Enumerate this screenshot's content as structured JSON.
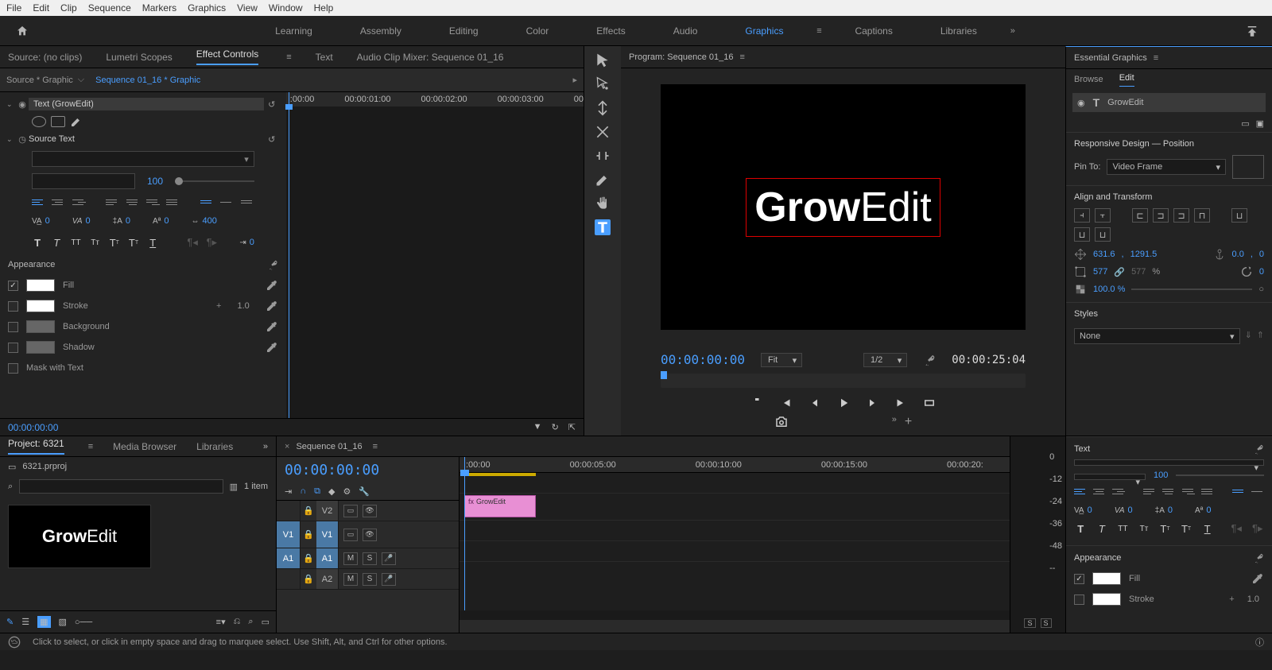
{
  "menu": {
    "items": [
      "File",
      "Edit",
      "Clip",
      "Sequence",
      "Markers",
      "Graphics",
      "View",
      "Window",
      "Help"
    ]
  },
  "workspaces": {
    "items": [
      "Learning",
      "Assembly",
      "Editing",
      "Color",
      "Effects",
      "Audio",
      "Graphics",
      "Captions",
      "Libraries"
    ],
    "active": "Graphics"
  },
  "sourcePanel": {
    "tabs": [
      "Source: (no clips)",
      "Lumetri Scopes",
      "Effect Controls",
      "Text",
      "Audio Clip Mixer: Sequence 01_16"
    ],
    "active": "Effect Controls"
  },
  "effectControls": {
    "source": "Source * Graphic",
    "sequence": "Sequence 01_16 * Graphic",
    "ruler": [
      ":00:00",
      "00:00:01:00",
      "00:00:02:00",
      "00:00:03:00",
      "00"
    ],
    "textLayer": "Text (GrowEdit)",
    "sourceText": "Source Text",
    "fontSize": "100",
    "tracking": "0",
    "kerning": "0",
    "leading": "0",
    "baseline": "0",
    "tsume": "400",
    "appearanceTitle": "Appearance",
    "fill": "Fill",
    "stroke": "Stroke",
    "strokeW": "1.0",
    "background": "Background",
    "shadow": "Shadow",
    "mask": "Mask with Text",
    "timecode": "00:00:00:00"
  },
  "program": {
    "title": "Program: Sequence 01_16",
    "textBold": "Grow",
    "textLight": "Edit",
    "timecode": "00:00:00:00",
    "fit": "Fit",
    "res": "1/2",
    "duration": "00:00:25:04"
  },
  "essentialGraphics": {
    "title": "Essential Graphics",
    "tabs": [
      "Browse",
      "Edit"
    ],
    "active": "Edit",
    "layerName": "GrowEdit",
    "responsive": "Responsive Design — Position",
    "pinTo": "Pin To:",
    "pinTarget": "Video Frame",
    "alignTransform": "Align and Transform",
    "posX": "631.6",
    "posY": "1291.5",
    "anchX": "0.0",
    "anchY": "0",
    "scaleW": "577",
    "scaleH": "577",
    "scalePct": "%",
    "rot": "0",
    "opacity": "100.0 %",
    "styles": "Styles",
    "styleNone": "None",
    "text": "Text",
    "textSize": "100",
    "trackingR": "0",
    "kerningR": "0",
    "leadingR": "0",
    "baselineR": "0",
    "appearance": "Appearance",
    "fillR": "Fill",
    "strokeR": "Stroke",
    "strokeWR": "1.0"
  },
  "project": {
    "tabs": [
      "Project: 6321",
      "Media Browser",
      "Libraries"
    ],
    "active": "Project: 6321",
    "filename": "6321.prproj",
    "items": "1 item",
    "thumbBold": "Grow",
    "thumbLight": "Edit"
  },
  "timeline": {
    "title": "Sequence 01_16",
    "timecode": "00:00:00:00",
    "ruler": [
      ":00:00",
      "00:00:05:00",
      "00:00:10:00",
      "00:00:15:00",
      "00:00:20:"
    ],
    "tracks": {
      "v2": "V2",
      "v1": "V1",
      "a1": "A1",
      "a2": "A2"
    },
    "clipName": "GrowEdit",
    "meterLabels": [
      "0",
      "-12",
      "-24",
      "-36",
      "-48",
      "--"
    ]
  },
  "status": "Click to select, or click in empty space and drag to marquee select. Use Shift, Alt, and Ctrl for other options."
}
